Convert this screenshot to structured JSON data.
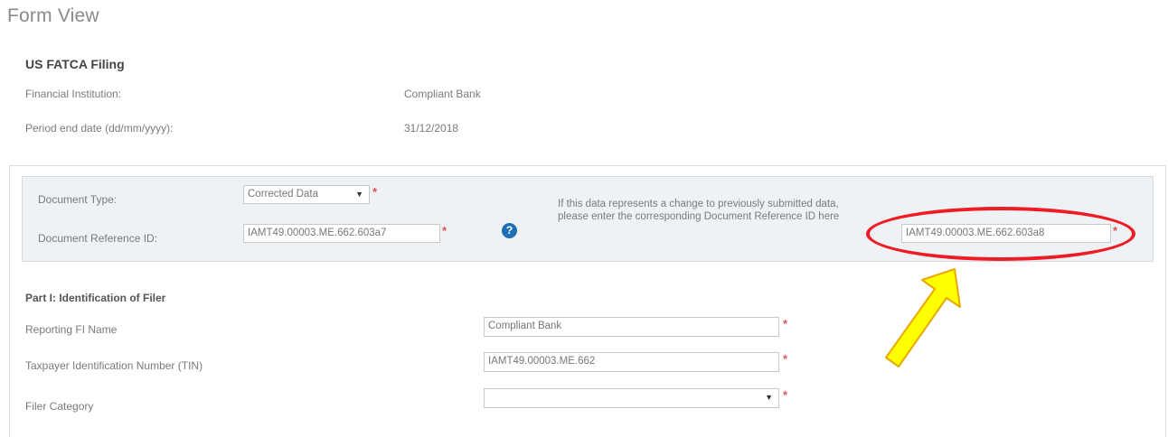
{
  "page": {
    "title": "Form View"
  },
  "filing": {
    "title": "US FATCA Filing",
    "institution_label": "Financial Institution:",
    "institution_value": "Compliant Bank",
    "period_label": "Period end date (dd/mm/yyyy):",
    "period_value": "31/12/2018"
  },
  "document": {
    "type_label": "Document Type:",
    "type_value": "Corrected Data",
    "ref_label": "Document Reference ID:",
    "ref_value": "IAMT49.00003.ME.662.603a7",
    "help_icon_glyph": "?",
    "corr_help_text": "If this data represents a change to previously submitted data, please enter the corresponding Document Reference ID here",
    "corr_ref_value": "IAMT49.00003.ME.662.603a8"
  },
  "part1": {
    "title": "Part I: Identification of Filer",
    "fi_name_label": "Reporting FI Name",
    "fi_name_value": "Compliant Bank",
    "tin_label": "Taxpayer Identification Number (TIN)",
    "tin_value": "IAMT49.00003.ME.662",
    "category_label": "Filer Category",
    "category_value": ""
  },
  "markers": {
    "required": "*",
    "caret": "▼"
  },
  "annotation": {
    "ellipse_color": "#ee1c25",
    "arrow_fill": "#ffff00",
    "arrow_stroke": "#e8a800"
  }
}
